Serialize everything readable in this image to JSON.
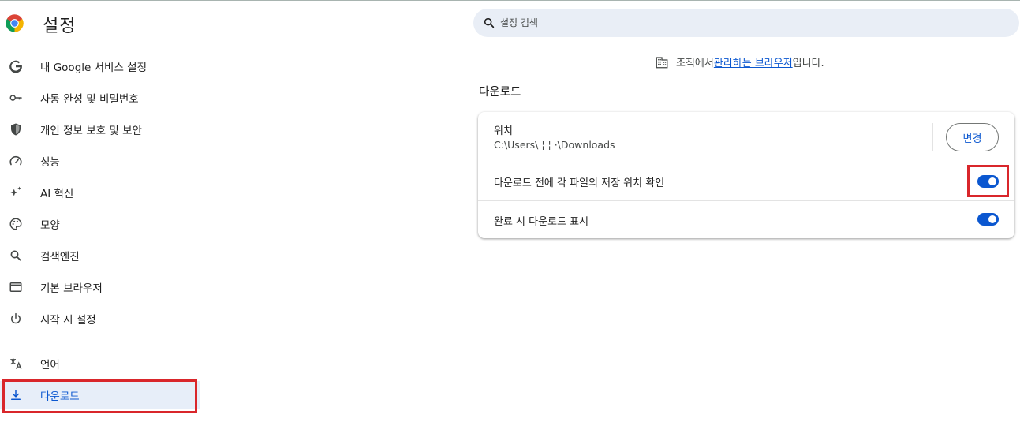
{
  "header": {
    "title": "설정",
    "search_placeholder": "설정 검색"
  },
  "sidebar": {
    "items": [
      {
        "label": "내 Google 서비스 설정",
        "icon": "google-g-icon"
      },
      {
        "label": "자동 완성 및 비밀번호",
        "icon": "key-icon"
      },
      {
        "label": "개인 정보 보호 및 보안",
        "icon": "shield-icon"
      },
      {
        "label": "성능",
        "icon": "speedometer-icon"
      },
      {
        "label": "AI 혁신",
        "icon": "sparkle-icon"
      },
      {
        "label": "모양",
        "icon": "palette-icon"
      },
      {
        "label": "검색엔진",
        "icon": "search-icon"
      },
      {
        "label": "기본 브라우저",
        "icon": "browser-window-icon"
      },
      {
        "label": "시작 시 설정",
        "icon": "power-icon"
      },
      {
        "label": "언어",
        "icon": "translate-icon"
      },
      {
        "label": "다운로드",
        "icon": "download-icon",
        "active": true
      }
    ]
  },
  "managed": {
    "before": "조직에서 ",
    "link": "관리하는 브라우저",
    "after": "입니다."
  },
  "downloads": {
    "section_title": "다운로드",
    "location_label": "위치",
    "location_path": "C:\\Users\\ ¦ ¦ ·\\Downloads",
    "change_button": "변경",
    "ask_label": "다운로드 전에 각 파일의 저장 위치 확인",
    "ask_enabled": true,
    "show_label": "완료 시 다운로드 표시",
    "show_enabled": true
  },
  "colors": {
    "accent": "#0b57d0",
    "highlight": "#d9262b",
    "active_bg": "#e7eef9",
    "search_bg": "#e9eef6"
  }
}
